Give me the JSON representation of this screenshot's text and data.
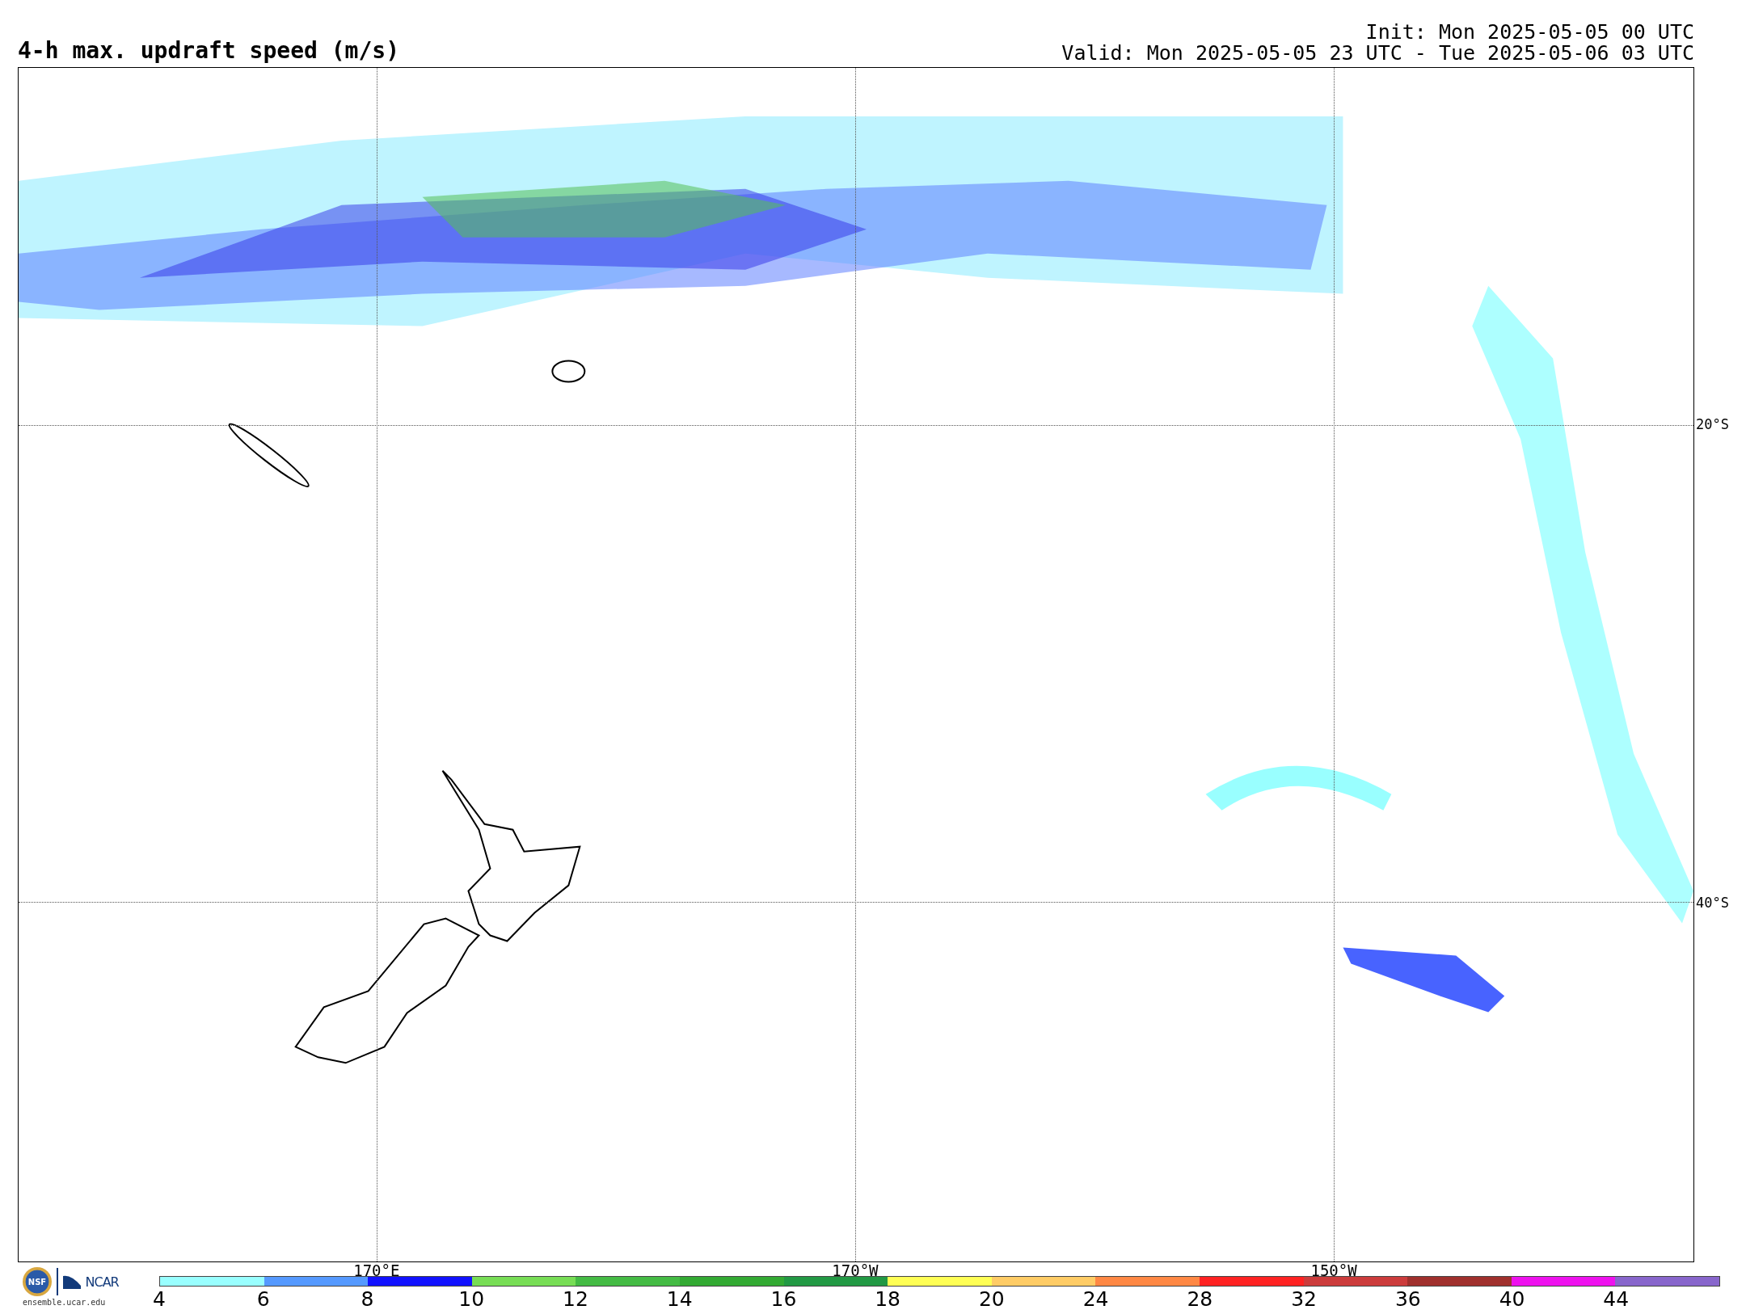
{
  "title": "4-h max. updraft speed (m/s)",
  "init": "Init: Mon 2025-05-05 00 UTC",
  "valid": "Valid: Mon 2025-05-05 23 UTC - Tue 2025-05-06 03 UTC",
  "map": {
    "latitudes": [
      {
        "label": "20°S"
      },
      {
        "label": "40°S"
      }
    ],
    "longitudes": [
      {
        "label": "170°E"
      },
      {
        "label": "170°W"
      },
      {
        "label": "150°W"
      }
    ]
  },
  "logos": {
    "seal": "NSF",
    "org": "NCAR",
    "site": "ensemble.ucar.edu"
  },
  "colorbar": [
    {
      "label": "4",
      "color": "#99ffff"
    },
    {
      "label": "6",
      "color": "#5599ff"
    },
    {
      "label": "8",
      "color": "#1111ff"
    },
    {
      "label": "10",
      "color": "#77dd55"
    },
    {
      "label": "12",
      "color": "#44bb44"
    },
    {
      "label": "14",
      "color": "#33aa33"
    },
    {
      "label": "16",
      "color": "#229944"
    },
    {
      "label": "18",
      "color": "#ffff55"
    },
    {
      "label": "20",
      "color": "#ffcc66"
    },
    {
      "label": "24",
      "color": "#ff8844"
    },
    {
      "label": "28",
      "color": "#ff2222"
    },
    {
      "label": "32",
      "color": "#cc3c3c"
    },
    {
      "label": "36",
      "color": "#a0302d"
    },
    {
      "label": "40",
      "color": "#ee11ee"
    },
    {
      "label": "44",
      "color": "#8866cc"
    }
  ]
}
